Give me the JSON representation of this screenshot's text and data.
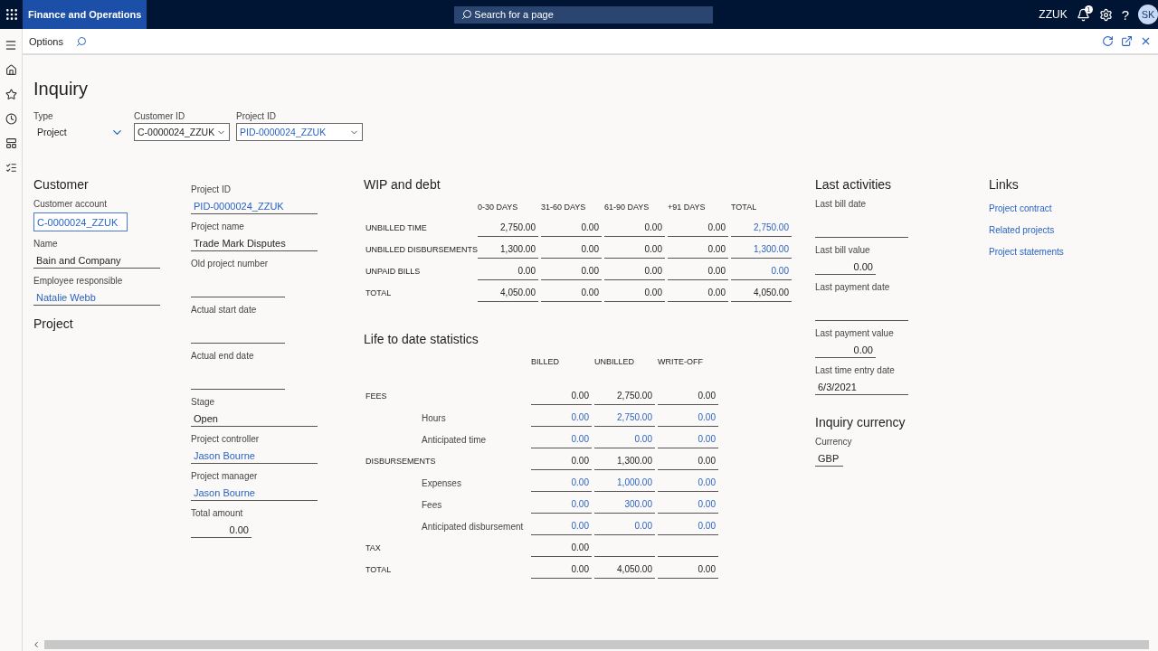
{
  "top_bar": {
    "app_title": "Finance and Operations",
    "search": {
      "placeholder": "Search for a page"
    },
    "company": "ZZUK",
    "notification_count": "1",
    "help": "?",
    "avatar": "SK"
  },
  "action_bar": {
    "options": "Options"
  },
  "page_title": "Inquiry",
  "filters": [
    {
      "label": "Type",
      "value": "Project",
      "kind": "select",
      "link": false
    },
    {
      "label": "Customer ID",
      "value": "C-0000024_ZZUK",
      "kind": "combo",
      "link": false
    },
    {
      "label": "Project ID",
      "value": "PID-0000024_ZZUK",
      "kind": "combo",
      "link": true
    }
  ],
  "customer": {
    "title": "Customer",
    "fields": [
      {
        "label": "Customer account",
        "value": "C-0000024_ZZUK",
        "link": true,
        "focused": true,
        "kind": "text"
      },
      {
        "label": "Name",
        "value": "Bain and Company",
        "link": false,
        "focused": false,
        "kind": "text"
      },
      {
        "label": "Employee responsible",
        "value": "Natalie Webb",
        "link": true,
        "focused": false,
        "kind": "text"
      }
    ]
  },
  "project": {
    "title": "Project",
    "fields": [
      {
        "label": "Project ID",
        "value": "PID-0000024_ZZUK",
        "link": true,
        "kind": "text"
      },
      {
        "label": "Project name",
        "value": "Trade Mark Disputes",
        "link": false,
        "kind": "text"
      },
      {
        "label": "Old project number",
        "kind": "date"
      },
      {
        "label": "Actual start date",
        "kind": "date"
      },
      {
        "label": "Actual end date",
        "kind": "date"
      },
      {
        "label": "Stage",
        "value": "Open",
        "link": false,
        "kind": "text"
      },
      {
        "label": "Project controller",
        "value": "Jason Bourne",
        "link": true,
        "kind": "text"
      },
      {
        "label": "Project manager",
        "value": "Jason Bourne",
        "link": true,
        "kind": "text"
      },
      {
        "label": "Total amount",
        "value": "0.00",
        "link": false,
        "kind": "amount"
      }
    ]
  },
  "wip": {
    "title": "WIP and debt",
    "columns": [
      "0-30 DAYS",
      "31-60 DAYS",
      "61-90 DAYS",
      "+91 DAYS",
      "TOTAL"
    ],
    "rows": [
      {
        "label": "UNBILLED TIME",
        "cells": [
          {
            "value": "2,750.00",
            "link": false
          },
          {
            "value": "0.00",
            "link": false
          },
          {
            "value": "0.00",
            "link": false
          },
          {
            "value": "0.00",
            "link": false
          },
          {
            "value": "2,750.00",
            "link": true
          }
        ]
      },
      {
        "label": "UNBILLED DISBURSEMENTS",
        "cells": [
          {
            "value": "1,300.00",
            "link": false
          },
          {
            "value": "0.00",
            "link": false
          },
          {
            "value": "0.00",
            "link": false
          },
          {
            "value": "0.00",
            "link": false
          },
          {
            "value": "1,300.00",
            "link": true
          }
        ]
      },
      {
        "label": "UNPAID BILLS",
        "cells": [
          {
            "value": "0.00",
            "link": false
          },
          {
            "value": "0.00",
            "link": false
          },
          {
            "value": "0.00",
            "link": false
          },
          {
            "value": "0.00",
            "link": false
          },
          {
            "value": "0.00",
            "link": true
          }
        ]
      },
      {
        "label": "TOTAL",
        "cells": [
          {
            "value": "4,050.00",
            "link": false
          },
          {
            "value": "0.00",
            "link": false
          },
          {
            "value": "0.00",
            "link": false
          },
          {
            "value": "0.00",
            "link": false
          },
          {
            "value": "4,050.00",
            "link": false
          }
        ]
      }
    ]
  },
  "life": {
    "title": "Life to date statistics",
    "columns": [
      "BILLED",
      "UNBILLED",
      "WRITE-OFF"
    ],
    "rows": [
      {
        "label": "FEES",
        "cells": [
          "0.00",
          "2,750.00",
          "0.00"
        ],
        "link": false,
        "children": [
          {
            "label": "Hours",
            "cells": [
              "0.00",
              "2,750.00",
              "0.00"
            ],
            "link": true
          },
          {
            "label": "Anticipated time",
            "cells": [
              "0.00",
              "0.00",
              "0.00"
            ],
            "link": true
          }
        ]
      },
      {
        "label": "DISBURSEMENTS",
        "cells": [
          "0.00",
          "1,300.00",
          "0.00"
        ],
        "link": false,
        "children": [
          {
            "label": "Expenses",
            "cells": [
              "0.00",
              "1,000.00",
              "0.00"
            ],
            "link": true
          },
          {
            "label": "Fees",
            "cells": [
              "0.00",
              "300.00",
              "0.00"
            ],
            "link": true
          },
          {
            "label": "Anticipated disbursement",
            "cells": [
              "0.00",
              "0.00",
              "0.00"
            ],
            "link": true
          }
        ]
      },
      {
        "label": "TAX",
        "cells": [
          "0.00"
        ],
        "link": false
      },
      {
        "label": "TOTAL",
        "cells": [
          "0.00",
          "4,050.00",
          "0.00"
        ],
        "link": false
      }
    ]
  },
  "last_activities": {
    "title": "Last activities",
    "fields": [
      {
        "label": "Last bill date",
        "kind": "date"
      },
      {
        "label": "Last bill value",
        "value": "0.00",
        "kind": "amount"
      },
      {
        "label": "Last payment date",
        "kind": "date"
      },
      {
        "label": "Last payment value",
        "value": "0.00",
        "kind": "amount"
      },
      {
        "label": "Last time entry date",
        "value": "6/3/2021",
        "kind": "text"
      }
    ]
  },
  "inquiry_currency": {
    "title": "Inquiry currency",
    "fields": [
      {
        "label": "Currency",
        "value": "GBP",
        "kind": "code"
      }
    ]
  },
  "links": {
    "title": "Links",
    "items": [
      "Project contract",
      "Related projects",
      "Project statements"
    ]
  }
}
